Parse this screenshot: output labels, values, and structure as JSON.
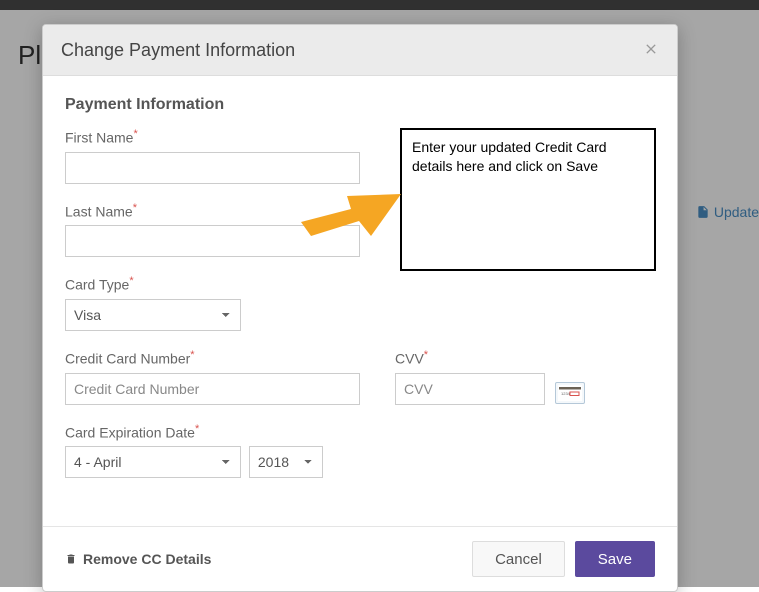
{
  "background": {
    "page_title": "Plan",
    "update_link": "Update "
  },
  "modal": {
    "title": "Change Payment Information",
    "section_title": "Payment Information",
    "info_text": "Enter your updated Credit Card details here and click on Save",
    "labels": {
      "first_name": "First Name",
      "last_name": "Last Name",
      "card_type": "Card Type",
      "cc_number": "Credit Card Number",
      "cvv": "CVV",
      "exp": "Card Expiration Date"
    },
    "values": {
      "first_name": "",
      "last_name": "",
      "card_type": "Visa",
      "cc_number": "",
      "cvv": "",
      "exp_month": "4 - April",
      "exp_year": "2018"
    },
    "placeholders": {
      "cc_number": "Credit Card Number",
      "cvv": "CVV"
    },
    "remove_label": "Remove CC Details",
    "cancel_label": "Cancel",
    "save_label": "Save"
  }
}
